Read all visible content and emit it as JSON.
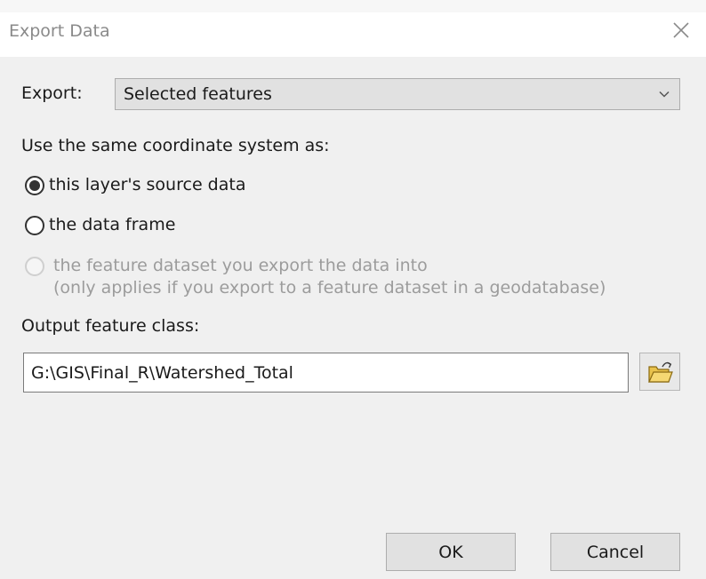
{
  "window": {
    "title": "Export Data"
  },
  "export": {
    "label": "Export:",
    "selected_value": "Selected features"
  },
  "coordinate_system": {
    "heading": "Use the same coordinate system as:",
    "options": [
      {
        "label": "this layer's source data",
        "checked": true,
        "enabled": true
      },
      {
        "label": "the data frame",
        "checked": false,
        "enabled": true
      },
      {
        "label": "the feature dataset you export the data into",
        "sub_label": "(only applies if you export to a feature dataset in a geodatabase)",
        "checked": false,
        "enabled": false
      }
    ]
  },
  "output": {
    "label": "Output feature class:",
    "value": "G:\\GIS\\Final_R\\Watershed_Total"
  },
  "buttons": {
    "ok_label": "OK",
    "cancel_label": "Cancel"
  },
  "icons": {
    "close": "close-icon",
    "dropdown": "chevron-down-icon",
    "browse": "open-folder-icon"
  }
}
